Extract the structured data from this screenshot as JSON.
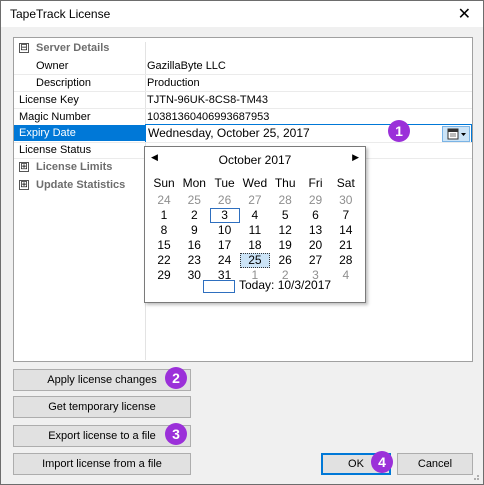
{
  "window": {
    "title": "TapeTrack License",
    "close_glyph": "✕"
  },
  "grid": {
    "server_details": {
      "label": "Server Details",
      "expander": "⊟",
      "owner_label": "Owner",
      "owner_value": "GazillaByte LLC",
      "description_label": "Description",
      "description_value": "Production"
    },
    "license_key_label": "License Key",
    "license_key_value": "TJTN-96UK-8CS8-TM43",
    "magic_number_label": "Magic Number",
    "magic_number_value": "10381360406993687953",
    "expiry_date_label": "Expiry Date",
    "expiry_date_value": "Wednesday,  October  25, 2017",
    "license_status_label": "License Status",
    "license_limits": {
      "label": "License Limits",
      "expander": "⊞"
    },
    "update_statistics": {
      "label": "Update Statistics",
      "expander": "⊞"
    }
  },
  "calendar": {
    "month_label": "October 2017",
    "prev": "◀",
    "next": "▶",
    "dow": [
      "Sun",
      "Mon",
      "Tue",
      "Wed",
      "Thu",
      "Fri",
      "Sat"
    ],
    "weeks": [
      [
        "24",
        "25",
        "26",
        "27",
        "28",
        "29",
        "30"
      ],
      [
        "1",
        "2",
        "3",
        "4",
        "5",
        "6",
        "7"
      ],
      [
        "8",
        "9",
        "10",
        "11",
        "12",
        "13",
        "14"
      ],
      [
        "15",
        "16",
        "17",
        "18",
        "19",
        "20",
        "21"
      ],
      [
        "22",
        "23",
        "24",
        "25",
        "26",
        "27",
        "28"
      ],
      [
        "29",
        "30",
        "31",
        "1",
        "2",
        "3",
        "4"
      ]
    ],
    "today_text": "Today: 10/3/2017"
  },
  "buttons": {
    "apply": "Apply license changes",
    "temporary": "Get temporary license",
    "export": "Export license to a file",
    "import": "Import license from a file",
    "ok": "OK",
    "cancel": "Cancel"
  },
  "badges": [
    "1",
    "2",
    "3",
    "4"
  ],
  "colors": {
    "selection": "#0078d7",
    "badge": "#9b30d9"
  }
}
